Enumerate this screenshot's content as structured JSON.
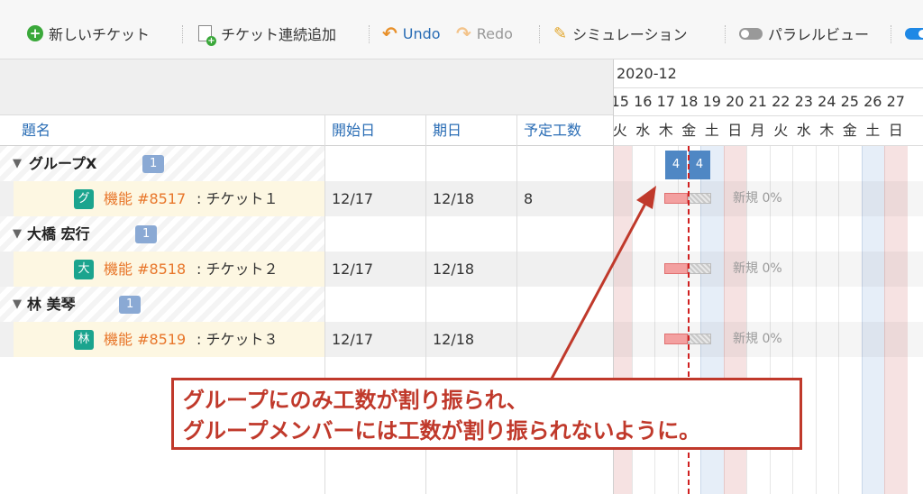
{
  "toolbar": {
    "new_ticket": "新しいチケット",
    "add_continuous": "チケット連続追加",
    "undo": "Undo",
    "redo": "Redo",
    "simulation": "シミュレーション",
    "parallel_view": "パラレルビュー"
  },
  "columns": {
    "subject": "題名",
    "start_date": "開始日",
    "due_date": "期日",
    "estimated_hours": "予定工数"
  },
  "groups": [
    {
      "name": "グループX",
      "count": "1",
      "task": {
        "avatar": "グ",
        "tracker": "機能 #8517",
        "title": ": チケット１",
        "start": "12/17",
        "due": "12/18",
        "hours": "8",
        "status": "新規 0%"
      }
    },
    {
      "name": "大橋 宏行",
      "count": "1",
      "task": {
        "avatar": "大",
        "tracker": "機能 #8518",
        "title": ": チケット２",
        "start": "12/17",
        "due": "12/18",
        "hours": "",
        "status": "新規 0%"
      }
    },
    {
      "name": "林 美琴",
      "count": "1",
      "task": {
        "avatar": "林",
        "tracker": "機能 #8519",
        "title": ": チケット３",
        "start": "12/17",
        "due": "12/18",
        "hours": "",
        "status": "新規 0%"
      }
    }
  ],
  "gantt": {
    "month": "2020-12",
    "days": [
      {
        "num": "15",
        "dow": "火",
        "kind": "hol"
      },
      {
        "num": "16",
        "dow": "水",
        "kind": ""
      },
      {
        "num": "17",
        "dow": "木",
        "kind": ""
      },
      {
        "num": "18",
        "dow": "金",
        "kind": ""
      },
      {
        "num": "19",
        "dow": "土",
        "kind": "sat"
      },
      {
        "num": "20",
        "dow": "日",
        "kind": "sun"
      },
      {
        "num": "21",
        "dow": "月",
        "kind": ""
      },
      {
        "num": "22",
        "dow": "火",
        "kind": ""
      },
      {
        "num": "23",
        "dow": "水",
        "kind": ""
      },
      {
        "num": "24",
        "dow": "木",
        "kind": ""
      },
      {
        "num": "25",
        "dow": "金",
        "kind": ""
      },
      {
        "num": "26",
        "dow": "土",
        "kind": "sat"
      },
      {
        "num": "27",
        "dow": "日",
        "kind": "sun"
      }
    ],
    "group_hours": [
      "4",
      "4"
    ]
  },
  "annotation": {
    "line1": "グループにのみ工数が割り振られ、",
    "line2": "グループメンバーには工数が割り振られないように。"
  },
  "colors": {
    "accent": "#2a6db5",
    "tracker": "#e8762a",
    "callout": "#c0392b",
    "group_bar": "#4f87c4",
    "avatar": "#1ba48e"
  }
}
